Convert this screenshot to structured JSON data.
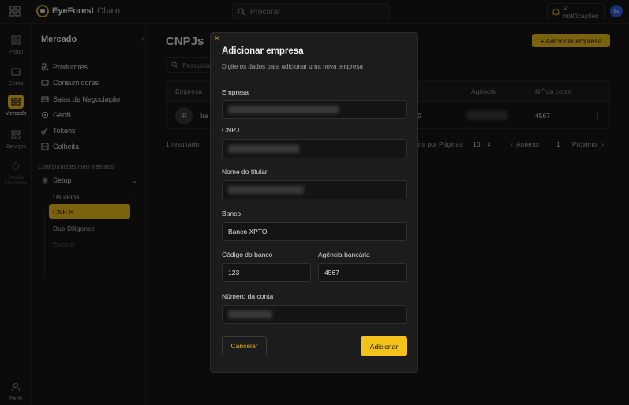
{
  "topbar": {
    "brand_part1": "EyeForest",
    "brand_part2": "Chain",
    "search_placeholder": "Procurar",
    "notifications": "2 notificações",
    "user_initial": "G"
  },
  "rail": [
    {
      "label": "Portal",
      "icon": "grid-icon"
    },
    {
      "label": "Conta",
      "icon": "wallet-icon"
    },
    {
      "label": "Mercado",
      "icon": "store-icon"
    },
    {
      "label": "Serviços",
      "icon": "services-icon"
    },
    {
      "label": "Gestão Financeira",
      "icon": "finance-icon"
    },
    {
      "label": "Perfil",
      "icon": "user-icon"
    }
  ],
  "sidebar": {
    "title": "Mercado",
    "items": [
      {
        "label": "Produtores",
        "icon": "tractor-icon"
      },
      {
        "label": "Consumidores",
        "icon": "people-icon"
      },
      {
        "label": "Salas de Negociação",
        "icon": "room-icon"
      },
      {
        "label": "GeoB",
        "icon": "geo-icon"
      },
      {
        "label": "Tokens",
        "icon": "key-icon"
      },
      {
        "label": "Colheita",
        "icon": "harvest-icon"
      }
    ],
    "section_label": "Configurações meu mercado",
    "setup_label": "Setup",
    "sub_items": [
      {
        "label": "Usuários"
      },
      {
        "label": "CNPJs"
      },
      {
        "label": "Due Diligence"
      },
      {
        "label": "Escrow"
      }
    ]
  },
  "main": {
    "title": "CNPJs",
    "add_button": "+ Adicionar empresa",
    "search_placeholder": "Pesquisar",
    "columns": [
      "Empresa",
      "Agência",
      "N.º da conta"
    ],
    "row": {
      "initials": "IR",
      "company_prefix": "Ira",
      "mid_fragment": "0",
      "account": "4567"
    },
    "result_count": "1 resultado",
    "pagination": {
      "per_page_label": "ns por Páginas",
      "per_page": "10",
      "prev": "Anterior",
      "page": "1",
      "next": "Próximo"
    }
  },
  "modal": {
    "close": "×",
    "title": "Adicionar empresa",
    "description": "Digite os dados para adicionar uma nova empresa",
    "fields": {
      "empresa_label": "Empresa",
      "cnpj_label": "CNPJ",
      "titular_label": "Nome do titular",
      "banco_label": "Banco",
      "banco_value": "Banco XPTO",
      "codigo_label": "Código do banco",
      "codigo_value": "123",
      "agencia_label": "Agência bancária",
      "agencia_value": "4567",
      "conta_label": "Número da conta"
    },
    "cancel": "Cancelar",
    "submit": "Adicionar"
  },
  "colors": {
    "accent": "#f2c21a",
    "background": "#141414",
    "modal_bg": "#1c1c1c"
  }
}
